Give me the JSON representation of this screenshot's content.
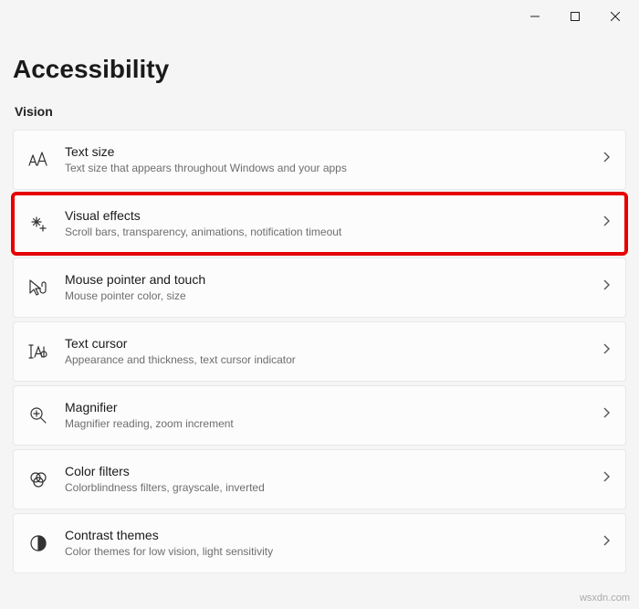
{
  "window": {
    "title": "Accessibility"
  },
  "section_label": "Vision",
  "items": [
    {
      "title": "Text size",
      "subtitle": "Text size that appears throughout Windows and your apps"
    },
    {
      "title": "Visual effects",
      "subtitle": "Scroll bars, transparency, animations, notification timeout"
    },
    {
      "title": "Mouse pointer and touch",
      "subtitle": "Mouse pointer color, size"
    },
    {
      "title": "Text cursor",
      "subtitle": "Appearance and thickness, text cursor indicator"
    },
    {
      "title": "Magnifier",
      "subtitle": "Magnifier reading, zoom increment"
    },
    {
      "title": "Color filters",
      "subtitle": "Colorblindness filters, grayscale, inverted"
    },
    {
      "title": "Contrast themes",
      "subtitle": "Color themes for low vision, light sensitivity"
    }
  ],
  "watermark": "wsxdn.com"
}
